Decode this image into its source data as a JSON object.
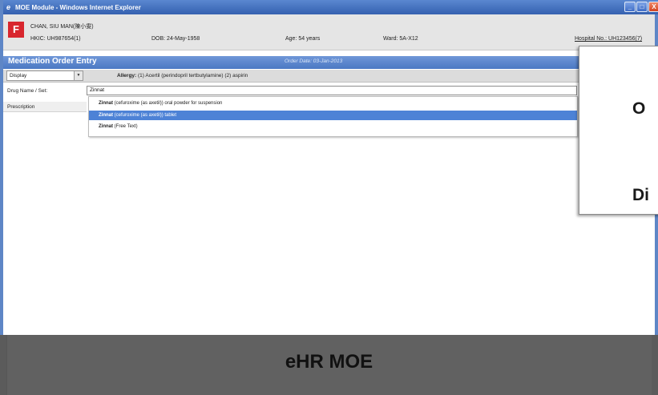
{
  "window": {
    "title": "MOE Module - Windows Internet Explorer",
    "buttons": [
      "_",
      "□",
      "X"
    ]
  },
  "patient": {
    "sex": "F",
    "name": "CHAN, SIU MAN(陳小雯)",
    "hkic": "HKIC: UH987654(1)",
    "dob": "DOB: 24-May-1958",
    "age": "Age: 54 years",
    "ward": "Ward: 5A-X12",
    "hospital_no": "Hospital No.: UH123456(7)"
  },
  "module": {
    "title": "Medication Order Entry",
    "order_date": "Order Date: 03-Jan-2013"
  },
  "toolbar": {
    "display_value": "Display",
    "allergy_label": "Allergy:",
    "allergy_text": "(1) Acertil (perindopril tertbutylamine) (2) aspirin"
  },
  "drug": {
    "label": "Drug Name / Set:",
    "value": "Zinnat"
  },
  "prescription_label": "Prescription",
  "suggestions": [
    {
      "name": "Zinnat",
      "detail": "(cefuroxime (as axetil)) oral powder for suspension",
      "selected": false
    },
    {
      "name": "Zinnat",
      "detail": "(cefuroxime (as axetil)) tablet",
      "selected": true
    },
    {
      "name": "Zinnat",
      "detail": "(Free Text)",
      "selected": false
    }
  ],
  "overlay": {
    "line1": "O",
    "line2": "Di"
  },
  "caption": "eHR MOE",
  "colors": {
    "titlebar": "#3d6cc6",
    "sex_badge": "#d8262e",
    "module_bar": "#5a86cf",
    "selected_row": "#4d82d6",
    "caption_band": "#5b5b5b"
  }
}
